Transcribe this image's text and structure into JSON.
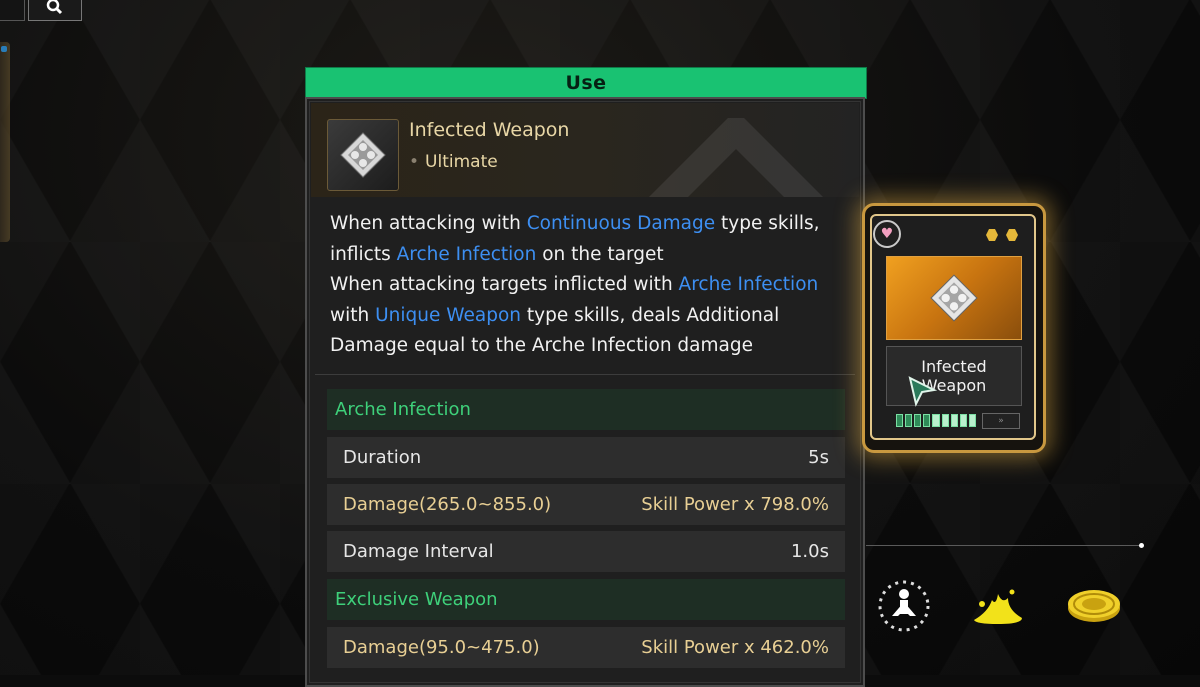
{
  "topbar": {
    "search_icon": "search-icon"
  },
  "tooltip": {
    "use_label": "Use",
    "item": {
      "name": "Infected Weapon",
      "rarity": "Ultimate",
      "icon": "module-diamond-icon"
    },
    "description": [
      [
        {
          "t": "When attacking with "
        },
        {
          "t": "Continuous Damage",
          "kw": true
        },
        {
          "t": " type skills,"
        }
      ],
      [
        {
          "t": "inflicts "
        },
        {
          "t": "Arche Infection",
          "kw": true
        },
        {
          "t": " on the target"
        }
      ],
      [
        {
          "t": "When attacking targets inflicted with "
        },
        {
          "t": "Arche Infection",
          "kw": true
        }
      ],
      [
        {
          "t": "with "
        },
        {
          "t": "Unique Weapon",
          "kw": true
        },
        {
          "t": " type skills, deals Additional"
        }
      ],
      [
        {
          "t": "Damage equal to the Arche Infection damage"
        }
      ]
    ],
    "sections": [
      {
        "title": "Arche Infection",
        "rows": [
          {
            "label": "Duration",
            "value": "5s",
            "gold": false
          },
          {
            "label": "Damage(265.0~855.0)",
            "value": "Skill Power x 798.0%",
            "gold": true
          },
          {
            "label": "Damage Interval",
            "value": "1.0s",
            "gold": false
          }
        ]
      },
      {
        "title": "Exclusive Weapon",
        "rows": [
          {
            "label": "Damage(95.0~475.0)",
            "value": "Skill Power x 462.0%",
            "gold": true
          }
        ]
      }
    ]
  },
  "card": {
    "name": "Infected Weapon",
    "favorite_icon": "heart-icon",
    "capacity_level_fraction": 0.55
  },
  "bottom_icons": [
    "figure-burst-icon",
    "yellow-splash-icon",
    "gold-disc-icon"
  ],
  "colors": {
    "accent_green": "#19c272",
    "keyword_blue": "#3d8ff2",
    "gold": "#e8cf94"
  }
}
